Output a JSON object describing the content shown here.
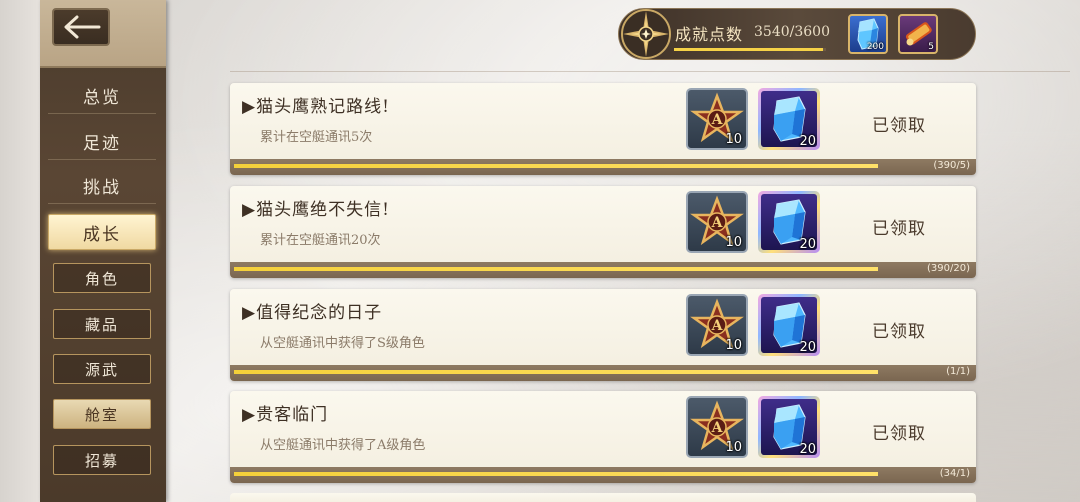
{
  "header": {
    "points_label": "成就点数",
    "points_value": "3540/3600",
    "points_progress": 0.983,
    "rewards": [
      {
        "icon": "blue-crystal-icon",
        "count": "200"
      },
      {
        "icon": "scroll-item-icon",
        "count": "5"
      }
    ]
  },
  "sidebar": {
    "back_icon": "back-arrow-icon",
    "main_items": [
      {
        "label": "总览",
        "active": false
      },
      {
        "label": "足迹",
        "active": false
      },
      {
        "label": "挑战",
        "active": false
      },
      {
        "label": "成长",
        "active": true
      }
    ],
    "sub_items": [
      {
        "label": "角色",
        "active": false
      },
      {
        "label": "藏品",
        "active": false
      },
      {
        "label": "源武",
        "active": false
      },
      {
        "label": "舱室",
        "active": true
      },
      {
        "label": "招募",
        "active": false
      }
    ]
  },
  "achievements": [
    {
      "title": "▶猫头鹰熟记路线!",
      "desc": "累计在空艇通讯5次",
      "reward_star": "10",
      "reward_crystal": "20",
      "status": "已领取",
      "progress_text": "(390/5)",
      "progress": 1.0
    },
    {
      "title": "▶猫头鹰绝不失信!",
      "desc": "累计在空艇通讯20次",
      "reward_star": "10",
      "reward_crystal": "20",
      "status": "已领取",
      "progress_text": "(390/20)",
      "progress": 1.0
    },
    {
      "title": "▶值得纪念的日子",
      "desc": "从空艇通讯中获得了S级角色",
      "reward_star": "10",
      "reward_crystal": "20",
      "status": "已领取",
      "progress_text": "(1/1)",
      "progress": 1.0
    },
    {
      "title": "▶贵客临门",
      "desc": "从空艇通讯中获得了A级角色",
      "reward_star": "10",
      "reward_crystal": "20",
      "status": "已领取",
      "progress_text": "(34/1)",
      "progress": 1.0
    }
  ],
  "colors": {
    "sidebar_bg": "#4a3b2c",
    "accent_gold": "#f6d247",
    "card_bg": "#fbf8ee"
  }
}
